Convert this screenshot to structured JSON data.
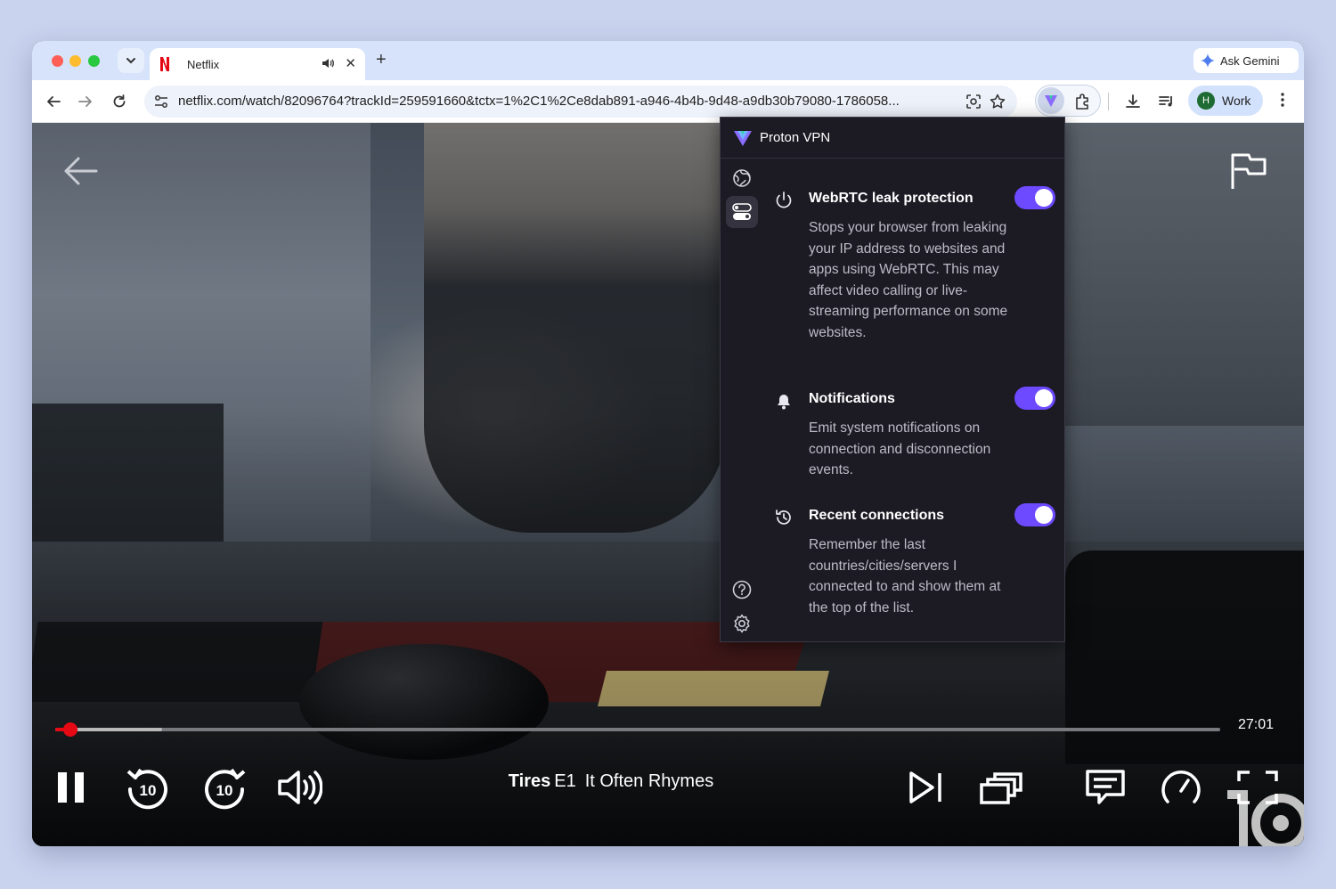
{
  "browser": {
    "tab": {
      "title": "Netflix"
    },
    "gemini_label": "Ask Gemini",
    "url": "netflix.com/watch/82096764?trackId=259591660&tctx=1%2C1%2Ce8dab891-a946-4b4b-9d48-a9db30b79080-1786058...",
    "profile": {
      "initial": "H",
      "label": "Work",
      "color": "#1e6b33"
    }
  },
  "player": {
    "time_remaining": "27:01",
    "progress_fraction": 0.013,
    "buffered_fraction": 0.092,
    "skip_back_seconds": "10",
    "skip_forward_seconds": "10",
    "show_title": "Tires",
    "episode_number": "E1",
    "episode_title": "It Often Rhymes",
    "accent_color": "#e50914"
  },
  "vpn": {
    "app_name": "Proton VPN",
    "accent_color": "#6d4aff",
    "settings": [
      {
        "icon": "power-icon",
        "title": "WebRTC leak protection",
        "description": "Stops your browser from leaking your IP address to websites and apps using WebRTC. This may affect video calling or live-streaming performance on some websites.",
        "enabled": true
      },
      {
        "icon": "bell-icon",
        "title": "Notifications",
        "description": "Emit system notifications on connection and disconnection events.",
        "enabled": true
      },
      {
        "icon": "history-icon",
        "title": "Recent connections",
        "description": "Remember the last countries/cities/servers I connected to and show them at the top of the list.",
        "enabled": true
      }
    ]
  }
}
